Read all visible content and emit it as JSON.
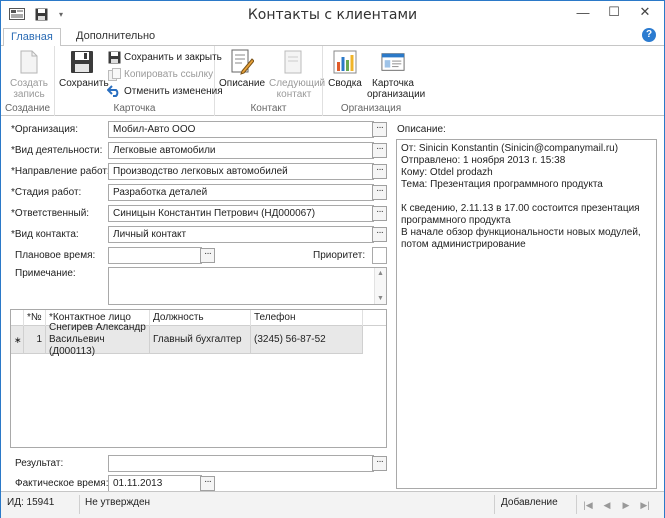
{
  "window": {
    "title": "Контакты с клиентами",
    "minimize_glyph": "—",
    "maximize_glyph": "☐",
    "close_glyph": "✕"
  },
  "tabs": [
    {
      "label": "Главная",
      "active": true
    },
    {
      "label": "Дополнительно",
      "active": false
    }
  ],
  "help_glyph": "?",
  "ribbon": {
    "groups": {
      "create": "Создание",
      "card": "Карточка",
      "contact": "Контакт",
      "organization": "Организация"
    },
    "create_record": {
      "line1": "Создать",
      "line2": "запись"
    },
    "save": "Сохранить",
    "save_close": "Сохранить и закрыть",
    "copy_link": "Копировать ссылку",
    "undo": "Отменить изменения",
    "description": "Описание",
    "next_contact": {
      "line1": "Следующий",
      "line2": "контакт"
    },
    "summary": "Сводка",
    "org_card": {
      "line1": "Карточка",
      "line2": "организации"
    }
  },
  "form": {
    "organization": {
      "label": "*Организация:",
      "value": "Мобил-Авто ООО"
    },
    "activity": {
      "label": "*Вид деятельности:",
      "value": "Легковые автомобили"
    },
    "direction": {
      "label": "*Направление работ:",
      "value": "Производство легковых автомобилей"
    },
    "stage": {
      "label": "*Стадия работ:",
      "value": "Разработка деталей"
    },
    "responsible": {
      "label": "*Ответственный:",
      "value": "Синицын Константин Петрович (НД000067)"
    },
    "contact_type": {
      "label": "*Вид контакта:",
      "value": "Личный контакт"
    },
    "planned_time": {
      "label": "Плановое время:",
      "value": ""
    },
    "priority": {
      "label": "Приоритет:"
    },
    "note": {
      "label": "Примечание:",
      "value": ""
    },
    "result": {
      "label": "Результат:",
      "value": ""
    },
    "actual_time": {
      "label": "Фактическое время:",
      "value": "01.11.2013"
    },
    "dots": "···"
  },
  "contacts_table": {
    "columns": [
      "*№",
      "*Контактное лицо",
      "Должность",
      "Телефон"
    ],
    "rows": [
      {
        "marker": "∗",
        "num": "1",
        "person": "Снегирев Александр Васильевич (Д000113)",
        "position": "Главный бухгалтер",
        "phone": "(3245) 56-87-52"
      }
    ]
  },
  "description": {
    "label": "Описание:",
    "lines": [
      "От:  Sinicin Konstantin (Sinicin@companymail.ru)",
      "Отправлено:  1 ноября 2013 г. 15:38",
      "Кому: Otdel prodazh",
      "Тема: Презентация программного продукта",
      "",
      "К сведению, 2.11.13 в 17.00 состоится презентация",
      "программного продукта",
      "В начале обзор функциональности новых модулей,",
      "потом администрирование"
    ]
  },
  "status": {
    "id": "ИД: 15941",
    "approval": "Не утвержден",
    "mode": "Добавление"
  }
}
